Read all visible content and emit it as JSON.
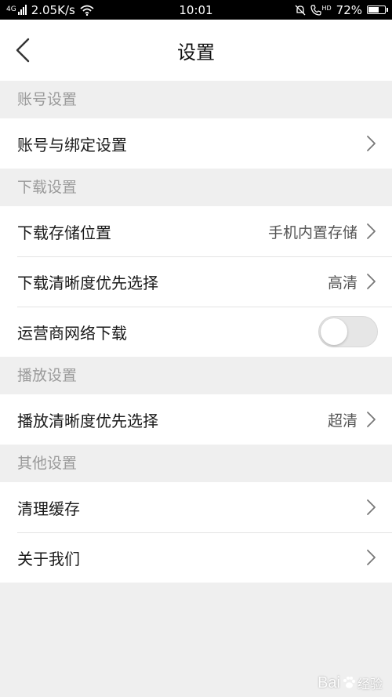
{
  "status_bar": {
    "network_type": "4G",
    "speed": "2.05K/s",
    "time": "10:01",
    "hd_label": "HD",
    "battery": "72%",
    "battery_level": 0.72
  },
  "header": {
    "title": "设置"
  },
  "sections": [
    {
      "title": "账号设置",
      "items": [
        {
          "label": "账号与绑定设置",
          "value": ""
        }
      ]
    },
    {
      "title": "下载设置",
      "items": [
        {
          "label": "下载存储位置",
          "value": "手机内置存储"
        },
        {
          "label": "下载清晰度优先选择",
          "value": "高清"
        },
        {
          "label": "运营商网络下载",
          "toggle": false
        }
      ]
    },
    {
      "title": "播放设置",
      "items": [
        {
          "label": "播放清晰度优先选择",
          "value": "超清"
        }
      ]
    },
    {
      "title": "其他设置",
      "items": [
        {
          "label": "清理缓存",
          "value": ""
        },
        {
          "label": "关于我们",
          "value": ""
        }
      ]
    }
  ],
  "watermark": {
    "text": "Bai",
    "suffix": "经验"
  },
  "colors": {
    "accent": "#ffffff",
    "section_bg": "#efefef",
    "muted_text": "#9a9a9a"
  }
}
